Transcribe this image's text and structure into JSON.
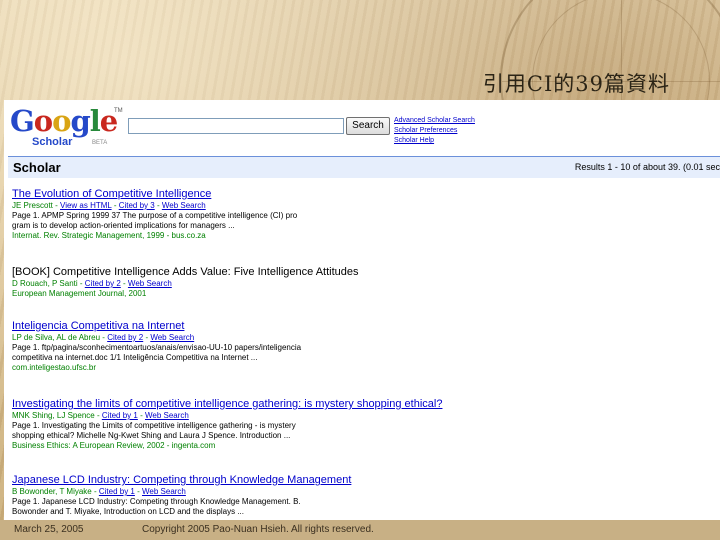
{
  "slide": {
    "title": "引用CI的39篇資料",
    "footer_date": "March 25, 2005",
    "footer_copyright": "Copyright 2005 Pao-Nuan Hsieh. All rights reserved."
  },
  "header": {
    "logo_letters": [
      "G",
      "o",
      "o",
      "g",
      "l",
      "e"
    ],
    "logo_tm": "TM",
    "logo_sub": "Scholar",
    "logo_beta": "BETA",
    "search_value": "",
    "search_button": "Search",
    "links": [
      "Advanced Scholar Search",
      "Scholar Preferences",
      "Scholar Help"
    ]
  },
  "scholar_bar": {
    "label": "Scholar",
    "results_count": "Results 1 - 10 of about 39. (0.01 sec"
  },
  "results": [
    {
      "title": "The Evolution of Competitive Intelligence",
      "meta": [
        "JE Prescott",
        "View as HTML",
        "Cited by 3",
        "Web Search"
      ],
      "snippet": [
        "Page 1. APMP Spring 1999 37 The purpose of a competitive intelligence (CI) pro",
        "gram is to develop action-oriented implications for managers ..."
      ],
      "source": "Internat. Rev. Strategic Management, 1999 - bus.co.za"
    },
    {
      "prefix": "[BOOK]",
      "title": "Competitive Intelligence Adds Value: Five Intelligence Attitudes",
      "meta": [
        "D Rouach, P Santi",
        "Cited by 2",
        "Web Search"
      ],
      "snippet": [],
      "source": "European Management Journal, 2001"
    },
    {
      "title": "Inteligencia Competitiva na Internet",
      "meta": [
        "LP de Silva, AL de Abreu",
        "Cited by 2",
        "Web Search"
      ],
      "snippet": [
        "Page 1. ftp/pagina/sconhecimentoartuos/anais/envisao-UU-10 papers/inteligencia",
        "competitiva na internet.doc 1/1 Inteligência Competitiva na Internet ..."
      ],
      "source": "com.inteligestao.ufsc.br"
    },
    {
      "title": "Investigating the limits of competitive intelligence gathering: is mystery shopping ethical?",
      "meta": [
        "MNK Shing, LJ Spence",
        "Cited by 1",
        "Web Search"
      ],
      "snippet": [
        "Page 1. Investigating the Limits of competitive intelligence gathering - is mystery",
        "shopping ethical? Michelle Ng-Kwet Shing and Laura J Spence. Introduction ..."
      ],
      "source": "Business Ethics: A European Review, 2002 - ingenta.com"
    },
    {
      "title": "Japanese LCD Industry: Competing through Knowledge Management",
      "meta": [
        "B Bowonder, T Miyake",
        "Cited by 1",
        "Web Search"
      ],
      "snippet": [
        "Page 1. Japanese LCD Industry: Competing through Knowledge Management. B.",
        "Bowonder and T. Miyake, Introduction on LCD and the displays ..."
      ],
      "source": ""
    }
  ],
  "colors": {
    "link": "#0000cc",
    "green": "#008000",
    "bar": "#e6eefc",
    "bar_border": "#6b90da"
  }
}
